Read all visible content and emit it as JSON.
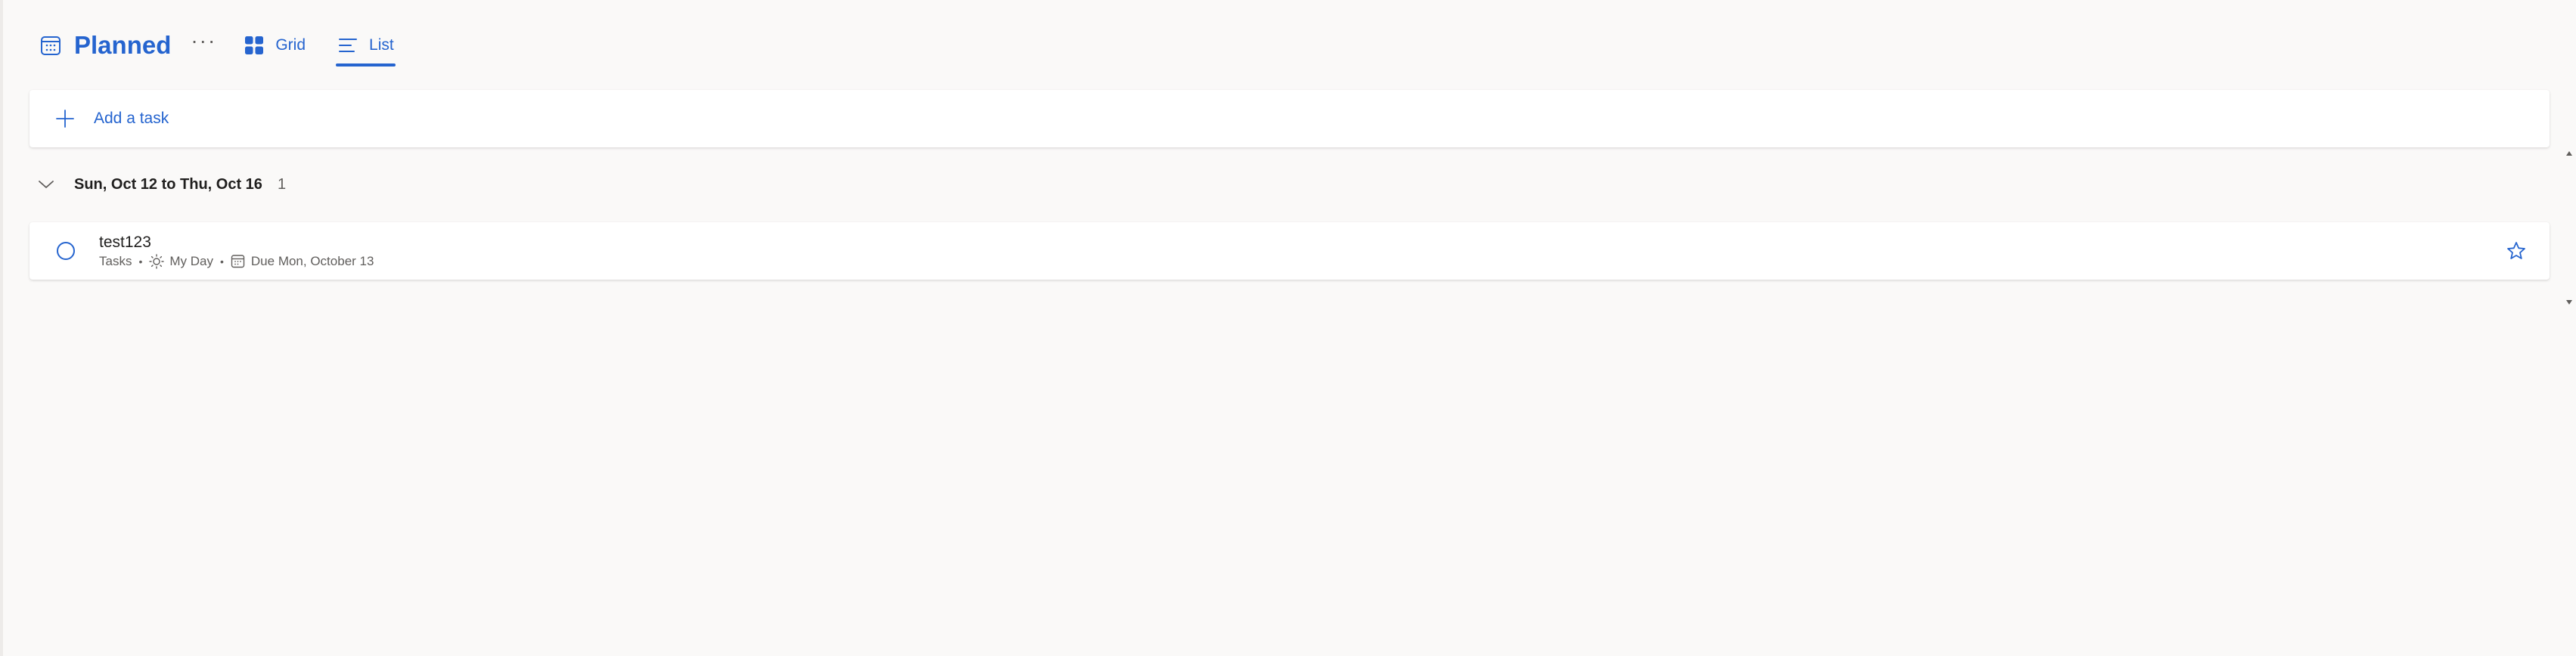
{
  "header": {
    "title": "Planned",
    "title_icon": "calendar-icon",
    "more_label": "···",
    "views": [
      {
        "label": "Grid",
        "icon": "grid-icon",
        "active": false
      },
      {
        "label": "List",
        "icon": "list-icon",
        "active": true
      }
    ]
  },
  "add_task": {
    "label": "Add a task",
    "icon": "plus-icon"
  },
  "groups": [
    {
      "title": "Sun, Oct 12 to Thu, Oct 16",
      "count": "1",
      "icon": "chevron-down-icon",
      "tasks": [
        {
          "title": "test123",
          "list": "Tasks",
          "my_day": "My Day",
          "due": "Due Mon, October 13",
          "starred": false
        }
      ]
    }
  ],
  "colors": {
    "accent": "#2564cf",
    "background": "#faf9f8",
    "card": "#ffffff",
    "secondary_text": "#605e5c"
  }
}
